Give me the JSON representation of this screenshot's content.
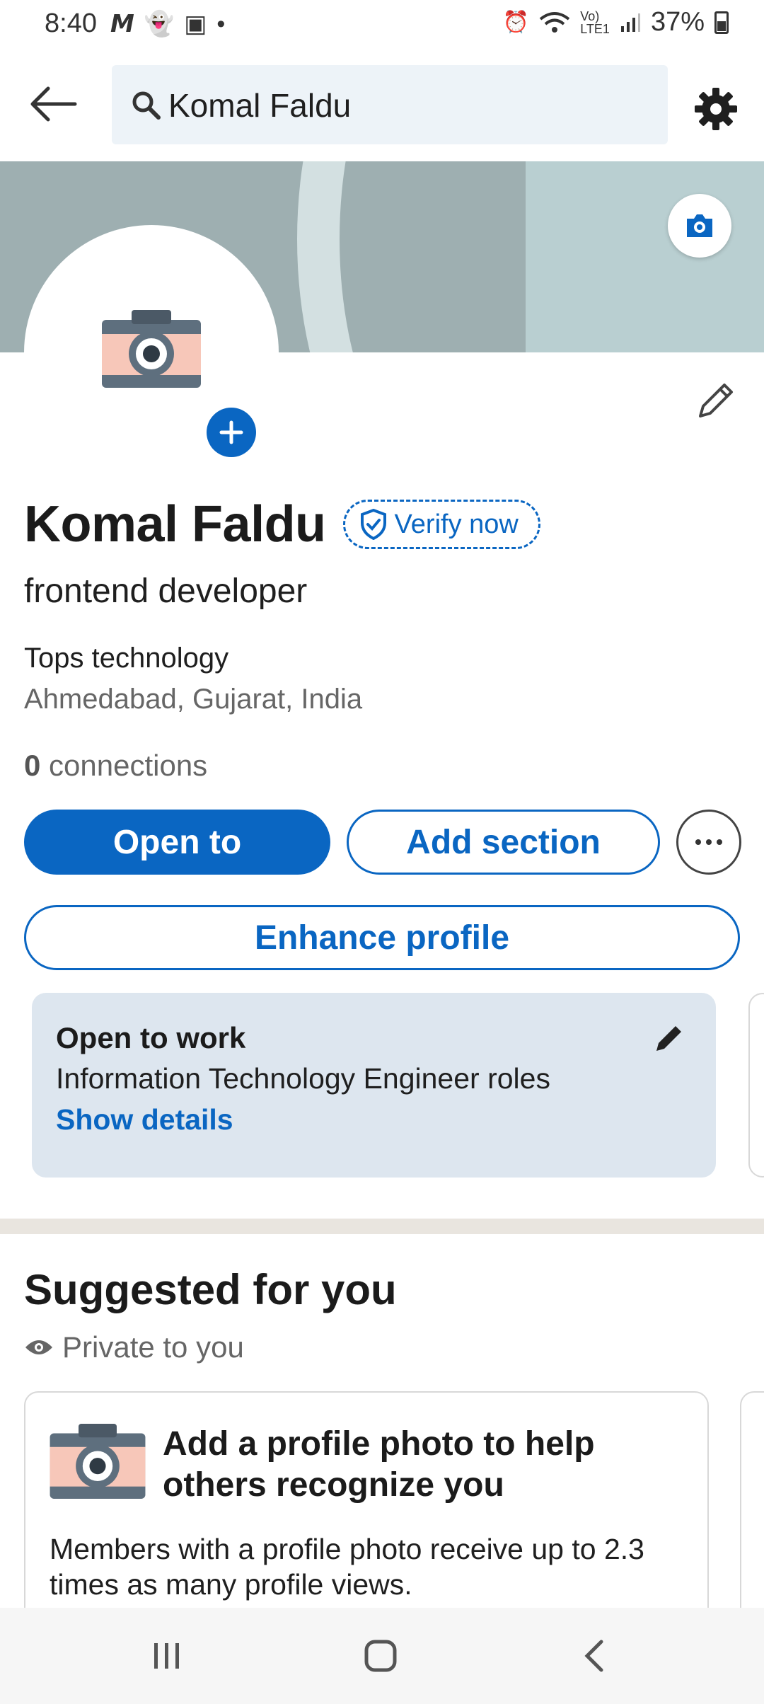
{
  "status_bar": {
    "time": "8:40",
    "battery": "37%",
    "left_icons": [
      "m-icon",
      "snapchat-icon",
      "gallery-icon",
      "dot-icon"
    ],
    "right_icons": [
      "alarm-icon",
      "wifi-icon",
      "volte-icon",
      "signal-icon",
      "battery-icon"
    ]
  },
  "header": {
    "search_value": "Komal Faldu"
  },
  "profile": {
    "name": "Komal Faldu",
    "verify_label": "Verify now",
    "headline": "frontend developer",
    "company": "Tops technology",
    "location": "Ahmedabad, Gujarat, India",
    "connections_count": "0",
    "connections_label": "connections"
  },
  "actions": {
    "open_to": "Open to",
    "add_section": "Add section",
    "enhance_profile": "Enhance profile"
  },
  "open_to_work": {
    "title": "Open to work",
    "subtitle": "Information Technology Engineer roles",
    "link": "Show details"
  },
  "suggested": {
    "title": "Suggested for you",
    "privacy": "Private to you",
    "card_title": "Add a profile photo to help others recognize you",
    "card_body": "Members with a profile photo receive up to 2.3 times as many profile views."
  },
  "colors": {
    "primary": "#0a66c2",
    "cover": "#9eafb1",
    "card_bg": "#dde6ef"
  }
}
